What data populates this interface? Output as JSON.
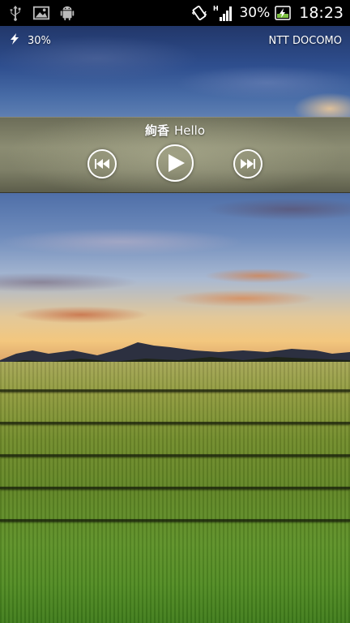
{
  "status_bar": {
    "battery_percent": "30%",
    "time": "18:23",
    "icons": [
      "usb-icon",
      "image-notification-icon",
      "android-debug-icon",
      "vibrate-icon",
      "signal-icon",
      "battery-charging-icon"
    ]
  },
  "lockscreen": {
    "battery_level": "30%",
    "carrier": "NTT DOCOMO"
  },
  "music": {
    "artist": "絢香",
    "title": "Hello"
  }
}
